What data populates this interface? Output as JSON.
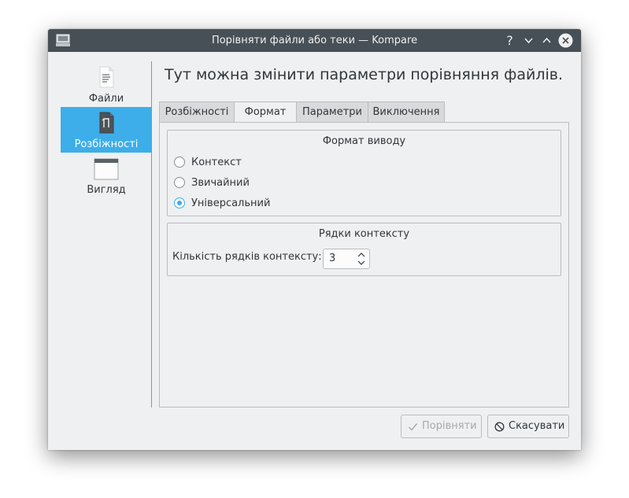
{
  "window": {
    "title": "Порівняти файли або теки — Kompare",
    "heading": "Тут можна змінити параметри порівняння файлів."
  },
  "titlebar": {
    "help_glyph": "?",
    "icons": [
      "app-icon",
      "minimize-icon",
      "maximize-icon",
      "close-icon"
    ]
  },
  "sidebar": {
    "items": [
      {
        "label": "Файли",
        "icon": "file-icon",
        "active": false
      },
      {
        "label": "Розбіжності",
        "icon": "diff-icon",
        "active": true
      },
      {
        "label": "Вигляд",
        "icon": "window-icon",
        "active": false
      }
    ]
  },
  "tabs": [
    {
      "label": "Розбіжності",
      "active": false
    },
    {
      "label": "Формат",
      "active": true
    },
    {
      "label": "Параметри",
      "active": false
    },
    {
      "label": "Виключення",
      "active": false
    }
  ],
  "format_group": {
    "title": "Формат виводу",
    "options": [
      {
        "label": "Контекст",
        "checked": false
      },
      {
        "label": "Звичайний",
        "checked": false
      },
      {
        "label": "Універсальний",
        "checked": true
      }
    ]
  },
  "context_group": {
    "title": "Рядки контексту",
    "spin_label": "Кількість рядків контексту:",
    "spin_value": "3"
  },
  "buttons": {
    "compare_label": "Порівняти",
    "compare_enabled": false,
    "cancel_label": "Скасувати"
  },
  "colors": {
    "accent": "#3daee9",
    "titlebar": "#475057",
    "window_bg": "#eff0f1"
  }
}
